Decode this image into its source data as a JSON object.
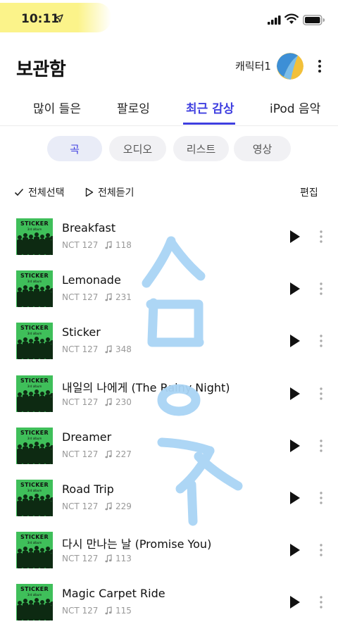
{
  "status_bar": {
    "time": "10:11"
  },
  "header": {
    "title": "보관함",
    "character_label": "캐릭터1"
  },
  "tabs": [
    {
      "label": "많이 들은"
    },
    {
      "label": "팔로잉"
    },
    {
      "label": "최근 감상",
      "active": true
    },
    {
      "label": "iPod 음악"
    }
  ],
  "chips": [
    {
      "label": "곡",
      "active": true
    },
    {
      "label": "오디오"
    },
    {
      "label": "리스트"
    },
    {
      "label": "영상"
    }
  ],
  "actions": {
    "select_all": "전체선택",
    "play_all": "전체듣기",
    "edit": "편집"
  },
  "album_cover": {
    "title": "STICKER",
    "subtitle": "3rd album"
  },
  "songs": [
    {
      "title": "Breakfast",
      "artist": "NCT 127",
      "plays": "118"
    },
    {
      "title": "Lemonade",
      "artist": "NCT 127",
      "plays": "231"
    },
    {
      "title": "Sticker",
      "artist": "NCT 127",
      "plays": "348"
    },
    {
      "title": "내일의 나에게 (The Rainy Night)",
      "artist": "NCT 127",
      "plays": "230"
    },
    {
      "title": "Dreamer",
      "artist": "NCT 127",
      "plays": "227"
    },
    {
      "title": "Road Trip",
      "artist": "NCT 127",
      "plays": "229"
    },
    {
      "title": "다시 만나는 날 (Promise You)",
      "artist": "NCT 127",
      "plays": "113"
    },
    {
      "title": "Magic Carpet Ride",
      "artist": "NCT 127",
      "plays": "115"
    }
  ],
  "colors": {
    "accent": "#3f3fe0",
    "cover_green": "#3fbf5a",
    "scribble": "#a9d4f5",
    "highlight": "#fbf38a"
  },
  "icons": [
    "location-arrow-icon",
    "signal-icon",
    "wifi-icon",
    "battery-icon",
    "more-vertical-icon",
    "check-icon",
    "play-outline-icon",
    "play-icon",
    "music-note-icon"
  ]
}
